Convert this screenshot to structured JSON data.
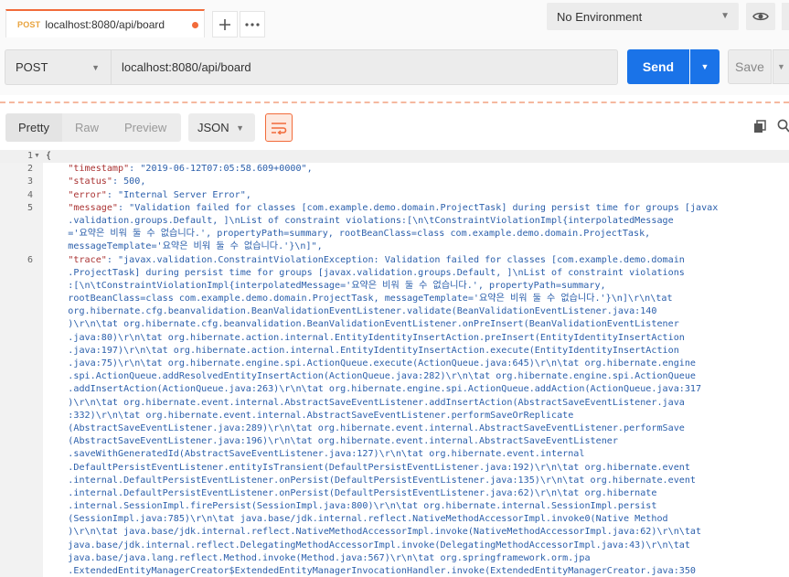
{
  "tab": {
    "method": "POST",
    "title": "localhost:8080/api/board"
  },
  "environment": {
    "label": "No Environment"
  },
  "request": {
    "method": "POST",
    "url": "localhost:8080/api/board",
    "send_label": "Send",
    "save_label": "Save"
  },
  "response_toolbar": {
    "tabs": [
      "Pretty",
      "Raw",
      "Preview"
    ],
    "active_tab": "Pretty",
    "format": "JSON"
  },
  "colors": {
    "accent": "#f26b3a",
    "send": "#1a73e8",
    "string": "#2b5fab",
    "key": "#a33333"
  },
  "code": {
    "lines": [
      {
        "num": "1",
        "text": "{"
      },
      {
        "num": "2",
        "key": "\"timestamp\"",
        "rest": ": \"2019-06-12T07:05:58.609+0000\","
      },
      {
        "num": "3",
        "key": "\"status\"",
        "rest": ": 500,"
      },
      {
        "num": "4",
        "key": "\"error\"",
        "rest": ": \"Internal Server Error\","
      },
      {
        "num": "5",
        "key": "\"message\"",
        "rest": ": \"Validation failed for classes [com.example.demo.domain.ProjectTask] during persist time for groups [javax"
      },
      {
        "num": "",
        "text": "    .validation.groups.Default, ]\\nList of constraint violations:[\\n\\tConstraintViolationImpl{interpolatedMessage"
      },
      {
        "num": "",
        "text": "    ='요약은 비워 둘 수 없습니다.', propertyPath=summary, rootBeanClass=class com.example.demo.domain.ProjectTask,"
      },
      {
        "num": "",
        "text": "    messageTemplate='요약은 비워 둘 수 없습니다.'}\\n]\","
      },
      {
        "num": "6",
        "key": "\"trace\"",
        "rest": ": \"javax.validation.ConstraintViolationException: Validation failed for classes [com.example.demo.domain"
      },
      {
        "num": "",
        "text": "    .ProjectTask] during persist time for groups [javax.validation.groups.Default, ]\\nList of constraint violations"
      },
      {
        "num": "",
        "text": "    :[\\n\\tConstraintViolationImpl{interpolatedMessage='요약은 비워 둘 수 없습니다.', propertyPath=summary,"
      },
      {
        "num": "",
        "text": "    rootBeanClass=class com.example.demo.domain.ProjectTask, messageTemplate='요약은 비워 둘 수 없습니다.'}\\n]\\r\\n\\tat"
      },
      {
        "num": "",
        "text": "    org.hibernate.cfg.beanvalidation.BeanValidationEventListener.validate(BeanValidationEventListener.java:140"
      },
      {
        "num": "",
        "text": "    )\\r\\n\\tat org.hibernate.cfg.beanvalidation.BeanValidationEventListener.onPreInsert(BeanValidationEventListener"
      },
      {
        "num": "",
        "text": "    .java:80)\\r\\n\\tat org.hibernate.action.internal.EntityIdentityInsertAction.preInsert(EntityIdentityInsertAction"
      },
      {
        "num": "",
        "text": "    .java:197)\\r\\n\\tat org.hibernate.action.internal.EntityIdentityInsertAction.execute(EntityIdentityInsertAction"
      },
      {
        "num": "",
        "text": "    .java:75)\\r\\n\\tat org.hibernate.engine.spi.ActionQueue.execute(ActionQueue.java:645)\\r\\n\\tat org.hibernate.engine"
      },
      {
        "num": "",
        "text": "    .spi.ActionQueue.addResolvedEntityInsertAction(ActionQueue.java:282)\\r\\n\\tat org.hibernate.engine.spi.ActionQueue"
      },
      {
        "num": "",
        "text": "    .addInsertAction(ActionQueue.java:263)\\r\\n\\tat org.hibernate.engine.spi.ActionQueue.addAction(ActionQueue.java:317"
      },
      {
        "num": "",
        "text": "    )\\r\\n\\tat org.hibernate.event.internal.AbstractSaveEventListener.addInsertAction(AbstractSaveEventListener.java"
      },
      {
        "num": "",
        "text": "    :332)\\r\\n\\tat org.hibernate.event.internal.AbstractSaveEventListener.performSaveOrReplicate"
      },
      {
        "num": "",
        "text": "    (AbstractSaveEventListener.java:289)\\r\\n\\tat org.hibernate.event.internal.AbstractSaveEventListener.performSave"
      },
      {
        "num": "",
        "text": "    (AbstractSaveEventListener.java:196)\\r\\n\\tat org.hibernate.event.internal.AbstractSaveEventListener"
      },
      {
        "num": "",
        "text": "    .saveWithGeneratedId(AbstractSaveEventListener.java:127)\\r\\n\\tat org.hibernate.event.internal"
      },
      {
        "num": "",
        "text": "    .DefaultPersistEventListener.entityIsTransient(DefaultPersistEventListener.java:192)\\r\\n\\tat org.hibernate.event"
      },
      {
        "num": "",
        "text": "    .internal.DefaultPersistEventListener.onPersist(DefaultPersistEventListener.java:135)\\r\\n\\tat org.hibernate.event"
      },
      {
        "num": "",
        "text": "    .internal.DefaultPersistEventListener.onPersist(DefaultPersistEventListener.java:62)\\r\\n\\tat org.hibernate"
      },
      {
        "num": "",
        "text": "    .internal.SessionImpl.firePersist(SessionImpl.java:800)\\r\\n\\tat org.hibernate.internal.SessionImpl.persist"
      },
      {
        "num": "",
        "text": "    (SessionImpl.java:785)\\r\\n\\tat java.base/jdk.internal.reflect.NativeMethodAccessorImpl.invoke0(Native Method"
      },
      {
        "num": "",
        "text": "    )\\r\\n\\tat java.base/jdk.internal.reflect.NativeMethodAccessorImpl.invoke(NativeMethodAccessorImpl.java:62)\\r\\n\\tat"
      },
      {
        "num": "",
        "text": "    java.base/jdk.internal.reflect.DelegatingMethodAccessorImpl.invoke(DelegatingMethodAccessorImpl.java:43)\\r\\n\\tat"
      },
      {
        "num": "",
        "text": "    java.base/java.lang.reflect.Method.invoke(Method.java:567)\\r\\n\\tat org.springframework.orm.jpa"
      },
      {
        "num": "",
        "text": "    .ExtendedEntityManagerCreator$ExtendedEntityManagerInvocationHandler.invoke(ExtendedEntityManagerCreator.java:350"
      }
    ]
  }
}
